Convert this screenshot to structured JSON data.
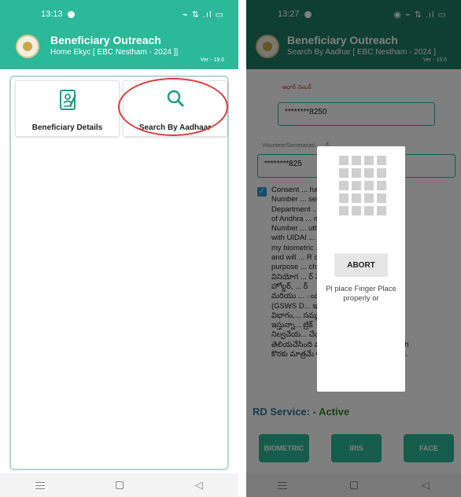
{
  "left": {
    "status": {
      "time": "13:13",
      "icons": "⌁ ⇅ .ıl ▭"
    },
    "app": {
      "title": "Beneficiary Outreach",
      "subtitle": "Home Ekyc [ EBC Nestham - 2024 ]]",
      "version": "Ver - 19.6"
    },
    "cards": [
      {
        "label": "Beneficiary Details",
        "icon": "document-person-icon"
      },
      {
        "label": "Search By Aadhaar",
        "icon": "search-icon"
      }
    ]
  },
  "right": {
    "status": {
      "time": "13:27",
      "icons": "◉ ⌁ ⇅ .ıl ▭"
    },
    "app": {
      "title": "Beneficiary Outreach",
      "subtitle": "Search By Aadhar [ EBC Nestham - 2024 ]",
      "version": "Ver - 19.6"
    },
    "aadhar_label": "ఆధార్ నెంబర్",
    "aadhar_value": "********8250",
    "volunteer_label": "Volunteer/Secretariat/... ...ర్",
    "volunteer_value": "********825",
    "consent_text": "Consent ... haar\nNumber ... sent to (GSWS\nDepartment ... vernment\nof Andhra ... my Aadhaar\nNumber ... uthencating\nwith UIDAI ... ormed that\nmy biometric ... red/shared\nand will ... R only for the\npurpose ... ch.\nవినియోగ ... ర్ నెంబర్\nహోల్డర్, ... ర్\nమరియు ... ందటానికి\n(GSWS D... ఇ & సి\nవిభాగం,... సమ్మతి\nఇస్తున్నా... ట్రిక్\nనిల్వచేయ... చేయబడదని\nతెలియచేసింది మరియు BeneficiaryOutreach\nకొరకు మాత్రమే CIDR కు సమర్పించబడుతుంది.",
    "rd_label": "RD Service: -",
    "rd_status": "Active",
    "buttons": [
      "BIOMETRIC",
      "IRIS",
      "FACE"
    ],
    "dialog": {
      "abort": "ABORT",
      "message": "Pl place Finger Place properly or"
    }
  }
}
